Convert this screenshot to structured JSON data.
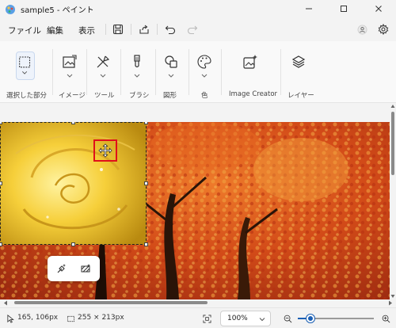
{
  "window": {
    "title": "sample5 - ペイント"
  },
  "menu": {
    "file": "ファイル",
    "edit": "編集",
    "view": "表示"
  },
  "ribbon": {
    "selection": "選択した部分",
    "image": "イメージ",
    "tools": "ツール",
    "brush": "ブラシ",
    "shapes": "図形",
    "color": "色",
    "image_creator": "Image Creator",
    "layers": "レイヤー"
  },
  "status": {
    "cursor_pos": "165, 106px",
    "selection_size": "255 × 213px",
    "zoom": "100%",
    "zoom_slider_fraction": 0.17
  },
  "colors": {
    "accent": "#1a5fb4",
    "highlight": "#e0101a"
  }
}
